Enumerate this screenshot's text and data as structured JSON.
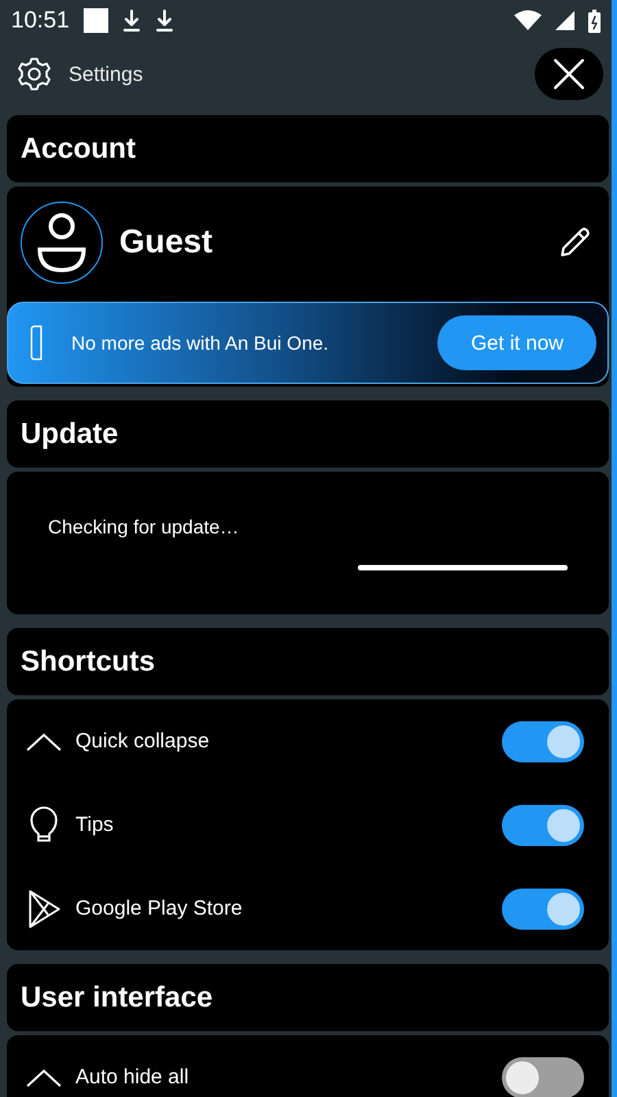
{
  "status_bar": {
    "time": "10:51"
  },
  "header": {
    "title": "Settings"
  },
  "account": {
    "title": "Account",
    "name": "Guest",
    "promo": {
      "text": "No more ads with An Bui One.",
      "button": "Get it now"
    }
  },
  "update": {
    "title": "Update",
    "message": "Checking for update…"
  },
  "sections": [
    {
      "title": "Shortcuts",
      "items": [
        {
          "label": "Quick collapse",
          "on": true
        },
        {
          "label": "Tips",
          "on": true
        },
        {
          "label": "Google Play Store",
          "on": true
        }
      ]
    },
    {
      "title": "User interface",
      "items": [
        {
          "label": "Auto hide all",
          "on": false
        }
      ]
    }
  ]
}
